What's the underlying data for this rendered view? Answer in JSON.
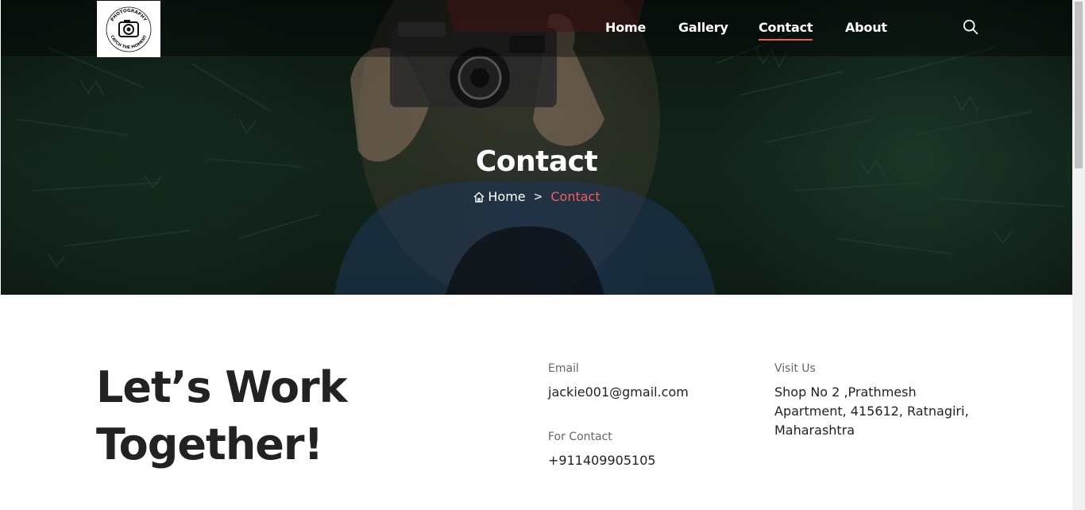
{
  "logo": {
    "top_text": "PHOTOGRAPHY",
    "bottom_text": "CATCH THE MOMENT"
  },
  "nav": {
    "items": [
      {
        "label": "Home",
        "active": false
      },
      {
        "label": "Gallery",
        "active": false
      },
      {
        "label": "Contact",
        "active": true
      },
      {
        "label": "About",
        "active": false
      }
    ],
    "search_icon": "search-icon"
  },
  "hero": {
    "title": "Contact",
    "breadcrumb": {
      "home_icon": "home-icon",
      "home_label": "Home",
      "separator": ">",
      "current": "Contact"
    }
  },
  "main": {
    "headline_line1": "Let’s Work",
    "headline_line2": "Together!",
    "email_label": "Email",
    "email_value": "jackie001@gmail.com",
    "phone_label": "For Contact",
    "phone_value": "+911409905105",
    "address_label": "Visit Us",
    "address_line1": "Shop No 2 ,Prathmesh",
    "address_line2": "Apartment, 415612, Ratnagiri,",
    "address_line3": "Maharashtra"
  },
  "colors": {
    "accent": "#f25c5c",
    "text_dark": "#222222",
    "text_muted": "#666666"
  }
}
